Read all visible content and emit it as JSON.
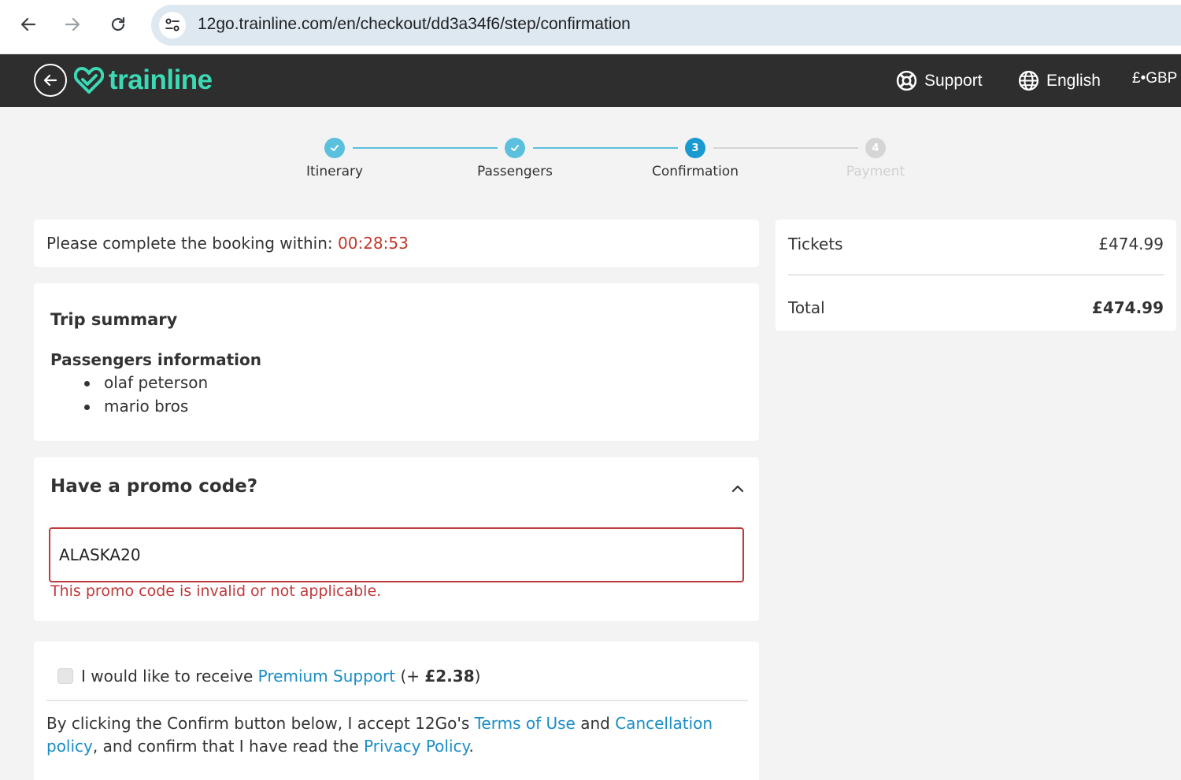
{
  "browser": {
    "url": "12go.trainline.com/en/checkout/dd3a34f6/step/confirmation"
  },
  "header": {
    "logo_text": "trainline",
    "support_label": "Support",
    "language_label": "English",
    "currency_label": "£•GBP",
    "brand_color": "#3dd9b5",
    "background_color": "#2e2e2e"
  },
  "stepper": {
    "steps": [
      {
        "label": "Itinerary",
        "state": "done",
        "icon": "check-icon"
      },
      {
        "label": "Passengers",
        "state": "done",
        "icon": "check-icon"
      },
      {
        "label": "Confirmation",
        "state": "current",
        "number": "3"
      },
      {
        "label": "Payment",
        "state": "upcoming",
        "number": "4"
      }
    ],
    "done_color": "#5bc0de",
    "current_color": "#1a9ad0",
    "upcoming_color": "#d5d5d5"
  },
  "timer": {
    "label": "Please complete the booking within: ",
    "time": "00:28:53"
  },
  "trip_summary": {
    "title": "Trip summary",
    "passengers_title": "Passengers information",
    "passengers": [
      "olaf peterson",
      "mario bros"
    ]
  },
  "promo": {
    "title": "Have a promo code?",
    "input_value": "ALASKA20",
    "error": "This promo code is invalid or not applicable.",
    "error_color": "#c0393b"
  },
  "premium_support": {
    "prefix": "I would like to receive ",
    "link": "Premium Support",
    "price_prefix": " (+ ",
    "price": "£2.38",
    "price_suffix": ")"
  },
  "terms": {
    "part1": "By clicking the Confirm button below, I accept 12Go's ",
    "terms_link": "Terms of Use",
    "part2": " and ",
    "cancellation_link": "Cancellation policy",
    "part3": ", and confirm that I have read the ",
    "privacy_link": "Privacy Policy",
    "part4": "."
  },
  "price_summary": {
    "tickets_label": "Tickets",
    "tickets_value": "£474.99",
    "total_label": "Total",
    "total_value": "£474.99"
  },
  "link_color": "#1a8dc6"
}
